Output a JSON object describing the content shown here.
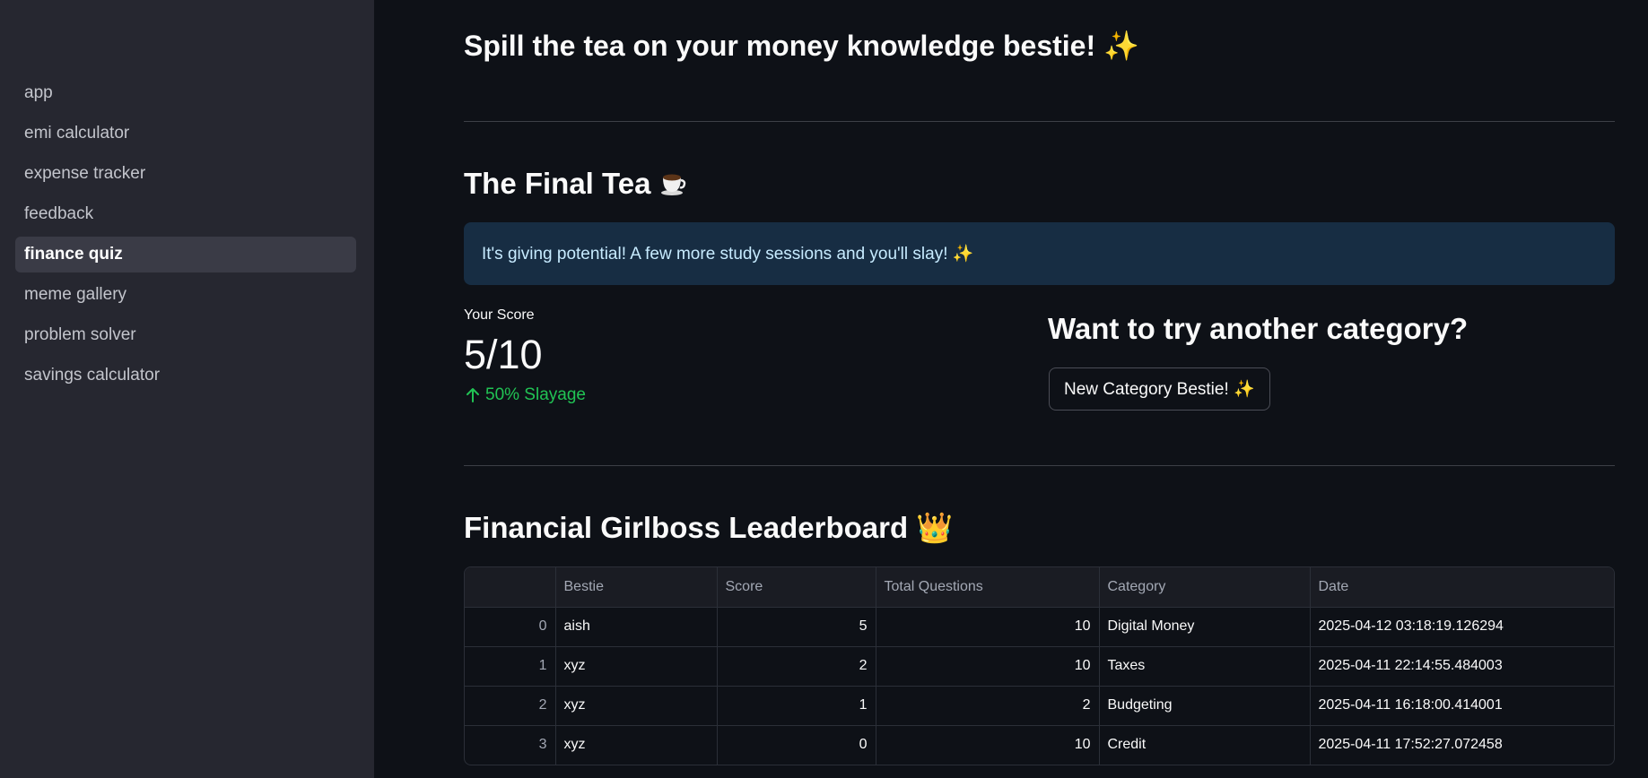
{
  "sidebar": {
    "items": [
      {
        "label": "app"
      },
      {
        "label": "emi calculator"
      },
      {
        "label": "expense tracker"
      },
      {
        "label": "feedback"
      },
      {
        "label": "finance quiz",
        "active": true
      },
      {
        "label": "meme gallery"
      },
      {
        "label": "problem solver"
      },
      {
        "label": "savings calculator"
      }
    ]
  },
  "header": {
    "title": "Spill the tea on your money knowledge bestie! ✨"
  },
  "results": {
    "heading": "The Final Tea",
    "heading_icon": "coffee-cup-icon",
    "info_message": "It's giving potential! A few more study sessions and you'll slay! ✨"
  },
  "metric": {
    "label": "Your Score",
    "value": "5/10",
    "delta": "50% Slayage",
    "delta_color": "#21c354"
  },
  "cta": {
    "heading": "Want to try another category?",
    "button_label": "New Category Bestie! ✨"
  },
  "leaderboard": {
    "heading": "Financial Girlboss Leaderboard 👑",
    "columns": [
      "",
      "Bestie",
      "Score",
      "Total Questions",
      "Category",
      "Date"
    ],
    "rows": [
      {
        "index": "0",
        "bestie": "aish",
        "score": "5",
        "total": "10",
        "category": "Digital Money",
        "date": "2025-04-12 03:18:19.126294"
      },
      {
        "index": "1",
        "bestie": "xyz",
        "score": "2",
        "total": "10",
        "category": "Taxes",
        "date": "2025-04-11 22:14:55.484003"
      },
      {
        "index": "2",
        "bestie": "xyz",
        "score": "1",
        "total": "2",
        "category": "Budgeting",
        "date": "2025-04-11 16:18:00.414001"
      },
      {
        "index": "3",
        "bestie": "xyz",
        "score": "0",
        "total": "10",
        "category": "Credit",
        "date": "2025-04-11 17:52:27.072458"
      }
    ]
  },
  "colors": {
    "background": "#0e1117",
    "sidebar": "#262730",
    "info_bg": "#172d43",
    "info_text": "#c7ebff",
    "success": "#21c354"
  }
}
